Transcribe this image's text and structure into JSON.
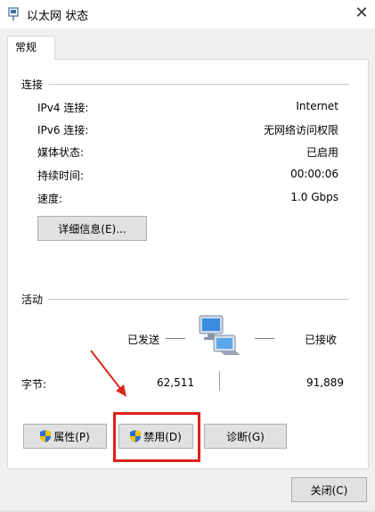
{
  "window": {
    "title": "以太网 状态",
    "close_glyph": "✕"
  },
  "tabs": [
    {
      "label": "常规"
    }
  ],
  "connection": {
    "header": "连接",
    "rows": [
      {
        "label": "IPv4 连接:",
        "value": "Internet"
      },
      {
        "label": "IPv6 连接:",
        "value": "无网络访问权限"
      },
      {
        "label": "媒体状态:",
        "value": "已启用"
      },
      {
        "label": "持续时间:",
        "value": "00:00:06"
      },
      {
        "label": "速度:",
        "value": "1.0 Gbps"
      }
    ],
    "details_button": "详细信息(E)..."
  },
  "activity": {
    "header": "活动",
    "sent_label": "已发送",
    "received_label": "已接收",
    "bytes_label": "字节:",
    "bytes_sent": "62,511",
    "bytes_received": "91,889",
    "network_icon": "network-computers-icon"
  },
  "actions": {
    "properties": "属性(P)",
    "disable": "禁用(D)",
    "diagnose": "诊断(G)"
  },
  "footer": {
    "close_button": "关闭(C)"
  },
  "annotation": {
    "arrow_color": "#d9271e",
    "highlight_color": "#e01e1e"
  },
  "colors": {
    "dialog_bg": "#f0f0f0",
    "panel_bg": "#ffffff",
    "button_bg": "#e1e1e1",
    "shield_blue": "#2a6fd6",
    "shield_yellow": "#f2c200"
  }
}
